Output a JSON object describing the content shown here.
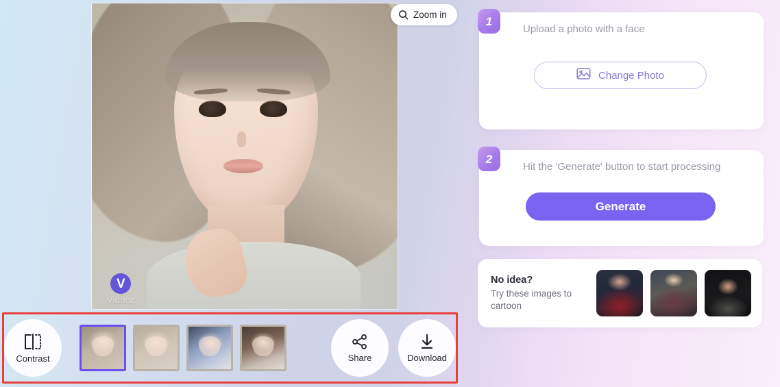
{
  "theme": {
    "accent_purple": "#7a63f0",
    "badge_purple": "#a77bea",
    "selection_purple": "#6a4ef0",
    "annotation_red": "#e8403c",
    "bg_left": "#cfe9f5",
    "bg_right": "#f9effa"
  },
  "preview": {
    "zoom_button": {
      "label": "Zoom in",
      "icon": "search-icon"
    },
    "watermark": {
      "logo": "V",
      "text": "Vidnoz"
    }
  },
  "toolbar": {
    "contrast": {
      "label": "Contrast",
      "icon": "contrast-icon"
    },
    "share": {
      "label": "Share",
      "icon": "share-icon"
    },
    "download": {
      "label": "Download",
      "icon": "download-icon"
    },
    "styles": [
      {
        "name": "style-1",
        "selected": true
      },
      {
        "name": "style-2",
        "selected": false
      },
      {
        "name": "style-3",
        "selected": false
      },
      {
        "name": "style-4",
        "selected": false
      }
    ]
  },
  "steps": [
    {
      "number": "1",
      "text": "Upload a photo with a face",
      "action": {
        "label": "Change Photo",
        "icon": "image-icon"
      }
    },
    {
      "number": "2",
      "text": "Hit the 'Generate' button to start processing",
      "action": {
        "label": "Generate"
      }
    }
  ],
  "ideas": {
    "title": "No idea?",
    "subtitle": "Try these images to cartoon",
    "samples": [
      {
        "name": "sample-superhero"
      },
      {
        "name": "sample-queen"
      },
      {
        "name": "sample-bald-man"
      }
    ]
  }
}
